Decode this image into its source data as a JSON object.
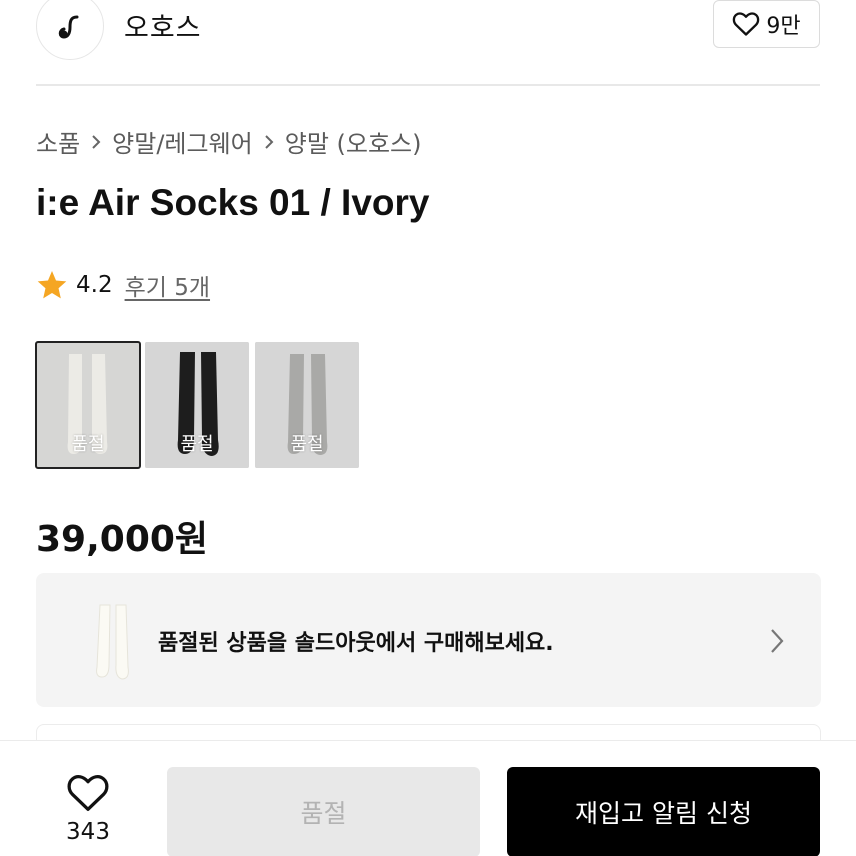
{
  "header": {
    "brand_name": "오호스",
    "brand_like_count": "9만"
  },
  "breadcrumb": [
    "소품",
    "양말/레그웨어",
    "양말 (오호스)"
  ],
  "product": {
    "title": "i:e Air Socks 01 / Ivory",
    "rating": "4.2",
    "reviews_label": "후기 5개",
    "price": "39,000원"
  },
  "swatches": [
    {
      "color": "ivory",
      "label": "품절",
      "selected": true
    },
    {
      "color": "black",
      "label": "품절",
      "selected": false
    },
    {
      "color": "gray",
      "label": "품절",
      "selected": false
    }
  ],
  "banner": {
    "message": "품절된 상품을 솔드아웃에서 구매해보세요."
  },
  "bottom_bar": {
    "wish_count": "343",
    "soldout_button": "품절",
    "restock_button": "재입고 알림 신청"
  },
  "colors": {
    "primary_button": "#000000",
    "disabled_button": "#e8e8e8",
    "star": "#f5a623"
  }
}
